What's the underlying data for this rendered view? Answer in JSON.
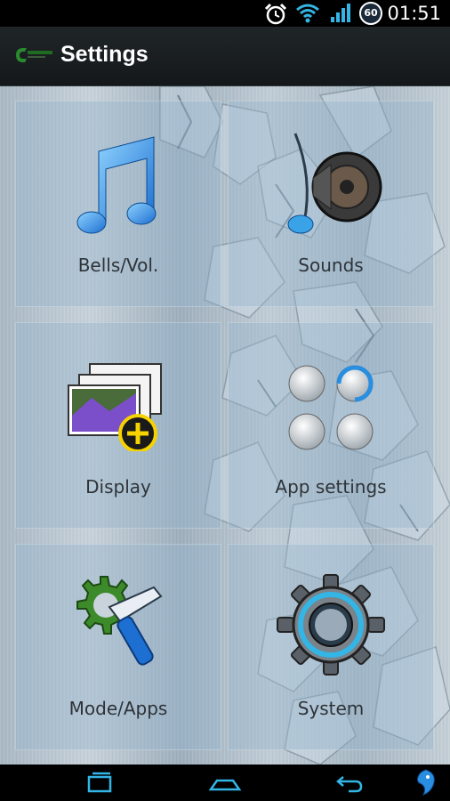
{
  "status_bar": {
    "time": "01:51",
    "battery_level": "60",
    "icons": [
      "alarm-icon",
      "wifi-icon",
      "signal-icon",
      "battery-icon"
    ]
  },
  "action_bar": {
    "title": "Settings",
    "logo_icon": "app-logo-icon"
  },
  "tiles": [
    {
      "label": "Bells/Vol.",
      "icon": "music-note-icon"
    },
    {
      "label": "Sounds",
      "icon": "speaker-icon"
    },
    {
      "label": "Display",
      "icon": "display-photos-icon"
    },
    {
      "label": "App settings",
      "icon": "app-grid-icon"
    },
    {
      "label": "Mode/Apps",
      "icon": "tools-icon"
    },
    {
      "label": "System",
      "icon": "gear-icon"
    }
  ],
  "nav_bar": {
    "buttons": [
      "recent-apps-icon",
      "home-icon",
      "back-icon",
      "dragon-logo-icon"
    ]
  },
  "colors": {
    "accent_blue": "#33b5e5",
    "action_bar_bg": "#1a1f22",
    "label_text": "#2e3338"
  }
}
